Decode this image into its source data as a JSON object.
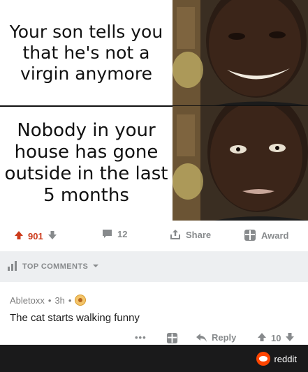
{
  "meme": {
    "top_caption": "Your son tells you that he's not a virgin anymore",
    "bottom_caption": "Nobody in your house has gone outside in the last 5 months"
  },
  "post_actions": {
    "upvotes": "901",
    "comments": "12",
    "share_label": "Share",
    "award_label": "Award"
  },
  "sort_bar": {
    "label": "TOP COMMENTS"
  },
  "comment": {
    "author": "Abletoxx",
    "separator": "•",
    "time": "3h",
    "body": "The cat starts walking funny",
    "more": "•••",
    "reply_label": "Reply",
    "votes": "10"
  },
  "footer": {
    "brand": "reddit"
  },
  "colors": {
    "upvote": "#cc3b1c",
    "muted": "#878a8c",
    "sortbar_bg": "#edeff1",
    "footer_bg": "#1a1a1b",
    "reddit_orange": "#ff4500"
  }
}
